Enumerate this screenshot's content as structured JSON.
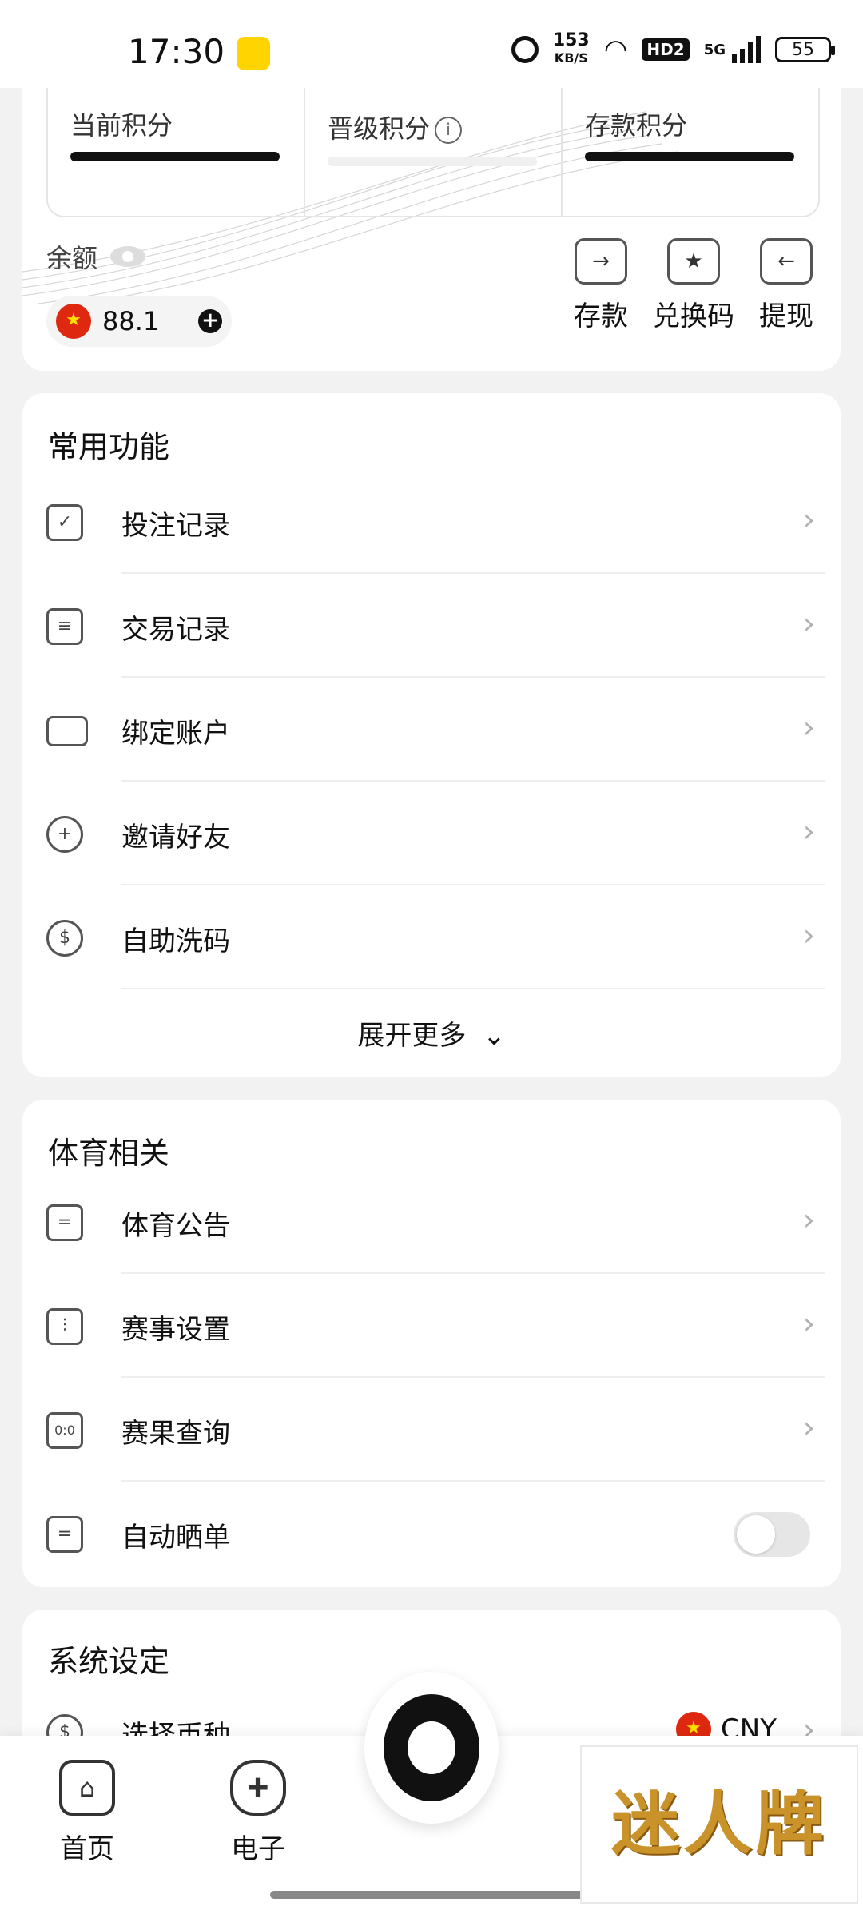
{
  "status_bar": {
    "time": "17:30",
    "net_speed_value": "153",
    "net_speed_unit": "KB/S",
    "hd_label": "HD2",
    "network": "5G",
    "battery": "55"
  },
  "points": {
    "current_label": "当前积分",
    "upgrade_label": "晋级积分",
    "deposit_label": "存款积分"
  },
  "balance": {
    "label": "余额",
    "value": "88.1",
    "currency_flag": "cn-flag"
  },
  "actions": [
    {
      "label": "存款",
      "icon": "deposit-icon"
    },
    {
      "label": "兑换码",
      "icon": "redeem-code-icon"
    },
    {
      "label": "提现",
      "icon": "withdraw-icon"
    }
  ],
  "common": {
    "title": "常用功能",
    "items": [
      {
        "label": "投注记录",
        "icon": "bet-record-icon"
      },
      {
        "label": "交易记录",
        "icon": "transaction-record-icon"
      },
      {
        "label": "绑定账户",
        "icon": "bind-card-icon"
      },
      {
        "label": "邀请好友",
        "icon": "invite-friend-icon"
      },
      {
        "label": "自助洗码",
        "icon": "rebate-icon"
      }
    ],
    "expand_label": "展开更多"
  },
  "sports": {
    "title": "体育相关",
    "items": [
      {
        "label": "体育公告",
        "icon": "announcement-icon"
      },
      {
        "label": "赛事设置",
        "icon": "settings-sliders-icon"
      },
      {
        "label": "赛果查询",
        "icon": "score-calendar-icon"
      },
      {
        "label": "自动晒单",
        "icon": "auto-share-icon",
        "toggle": false
      }
    ]
  },
  "system": {
    "title": "系统设定",
    "items": [
      {
        "label": "选择币种",
        "value": "CNY",
        "icon": "currency-icon"
      }
    ]
  },
  "tabs": [
    {
      "label": "首页",
      "icon": "home-icon"
    },
    {
      "label": "电子",
      "icon": "gamepad-icon"
    }
  ],
  "watermark": "迷人牌"
}
